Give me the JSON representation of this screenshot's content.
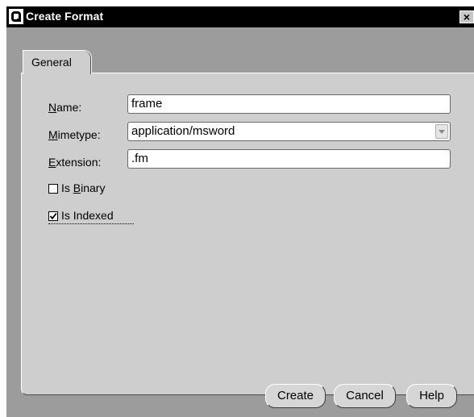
{
  "window": {
    "title": "Create Format",
    "close_glyph": "×"
  },
  "tabs": [
    {
      "label": "General"
    }
  ],
  "form": {
    "name_label_u": "N",
    "name_label_rest": "ame:",
    "name_value": "frame",
    "mimetype_label_u": "M",
    "mimetype_label_rest": "imetype:",
    "mimetype_value": "application/msword",
    "extension_label_u": "E",
    "extension_label_rest": "xtension:",
    "extension_value": ".fm",
    "is_binary_pre": "Is ",
    "is_binary_u": "B",
    "is_binary_rest": "inary",
    "is_binary_checked": false,
    "is_indexed_label": "Is Indexed",
    "is_indexed_checked": true
  },
  "buttons": {
    "create": "Create",
    "cancel": "Cancel",
    "help": "Help"
  },
  "icons": {
    "app": "oracle-logo-icon",
    "close": "close-icon",
    "dropdown": "chevron-down-icon",
    "check": "checkmark-icon"
  }
}
